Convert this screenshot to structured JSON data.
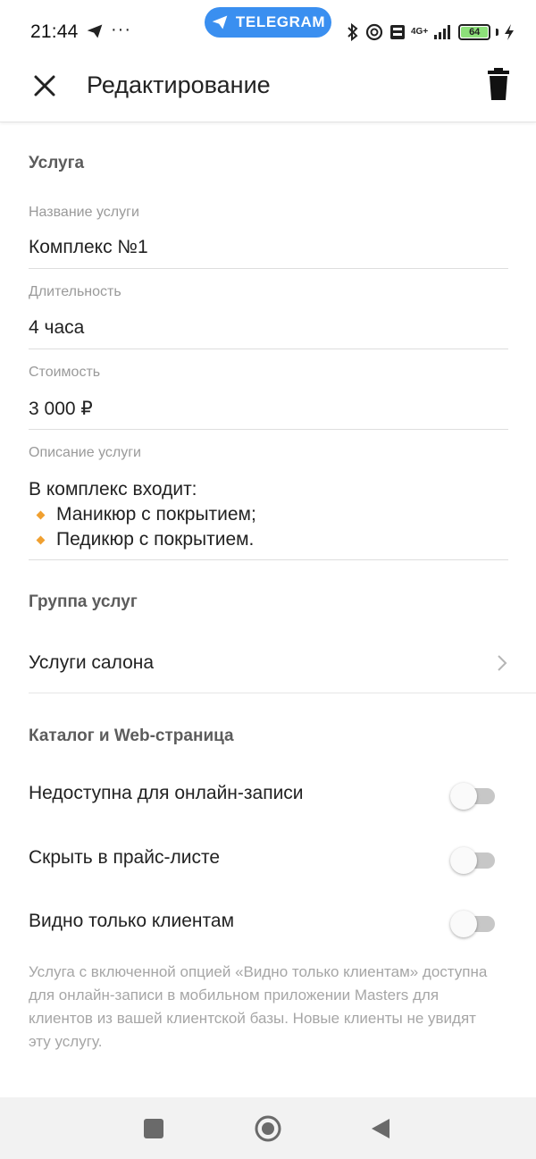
{
  "status_bar": {
    "time": "21:44",
    "dots": "···",
    "pill_label": "TELEGRAM",
    "network": "4G+",
    "battery": "64",
    "icons": [
      "telegram-send-icon",
      "bluetooth-icon",
      "link-icon",
      "volte-icon",
      "signal-icon",
      "charging-icon"
    ]
  },
  "header": {
    "title": "Редактирование",
    "close_icon": "close-icon",
    "delete_icon": "trash-icon"
  },
  "service": {
    "heading": "Услуга",
    "name_label": "Название услуги",
    "name_value": "Комплекс №1",
    "duration_label": "Длительность",
    "duration_value": "4 часа",
    "price_label": "Стоимость",
    "price_value": "3 000 ₽",
    "description_label": "Описание услуги",
    "description_intro": "В комплекс входит:",
    "description_items": [
      "Маникюр с покрытием;",
      "Педикюр с покрытием."
    ]
  },
  "group": {
    "heading": "Группа услуг",
    "value": "Услуги салона"
  },
  "catalog": {
    "heading": "Каталог и Web-страница",
    "toggles": [
      {
        "label": "Недоступна для онлайн-записи",
        "enabled": false
      },
      {
        "label": "Скрыть в прайс-листе",
        "enabled": false
      },
      {
        "label": "Видно только клиентам",
        "enabled": false
      }
    ],
    "footnote": "Услуга с включенной опцией «Видно только клиентам» доступна для онлайн-записи в мобильном приложении Masters для клиентов из вашей клиентской базы. Новые клиенты не увидят эту услугу."
  },
  "colors": {
    "accent_pill": "#3a8ff0",
    "bullet": "#f0a030",
    "toggle_off": "#c7c7c7",
    "battery": "#8de07a"
  }
}
